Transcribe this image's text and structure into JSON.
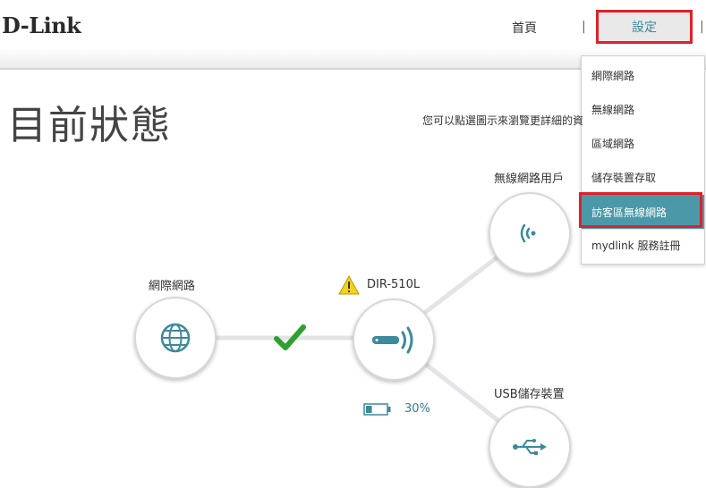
{
  "header": {
    "logo": "D-Link",
    "nav": {
      "home": "首頁",
      "settings": "設定",
      "separator": "|"
    }
  },
  "dropdown": {
    "items": [
      {
        "label": "網際網路"
      },
      {
        "label": "無線網路"
      },
      {
        "label": "區域網路"
      },
      {
        "label": "儲存裝置存取"
      },
      {
        "label": "訪客區無線網路",
        "active": true
      },
      {
        "label": "mydlink 服務註冊"
      }
    ]
  },
  "main": {
    "title": "目前狀態",
    "hint": "您可以點選圖示來瀏覽更詳細的資"
  },
  "nodes": {
    "internet": {
      "label": "網際網路",
      "icon": "globe-icon"
    },
    "router": {
      "label": "DIR-510L",
      "icon": "router-icon",
      "warning_icon": "warning-icon"
    },
    "wireless_clients": {
      "label": "無線網路用戶",
      "icon": "wifi-signal-icon"
    },
    "usb_storage": {
      "label": "USB儲存裝置",
      "icon": "usb-icon"
    }
  },
  "connection": {
    "internet_status_icon": "checkmark-icon"
  },
  "battery": {
    "percent": "30%",
    "level": 0.3
  },
  "colors": {
    "accent": "#3c8a9a",
    "highlight": "#e0202a",
    "active_bg": "#4a98a8",
    "check": "#2ea02e"
  }
}
